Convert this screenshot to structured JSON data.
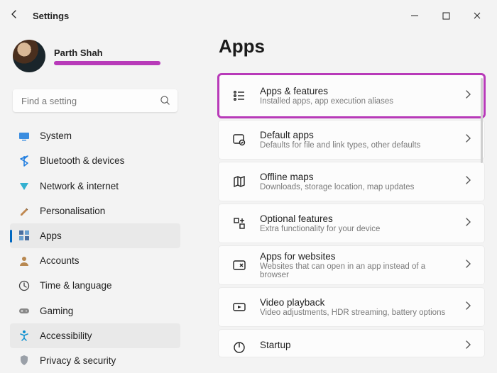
{
  "window": {
    "title": "Settings"
  },
  "profile": {
    "name": "Parth Shah"
  },
  "search": {
    "placeholder": "Find a setting"
  },
  "nav": {
    "items": [
      {
        "label": "System",
        "icon": "system"
      },
      {
        "label": "Bluetooth & devices",
        "icon": "bluetooth"
      },
      {
        "label": "Network & internet",
        "icon": "network"
      },
      {
        "label": "Personalisation",
        "icon": "personalisation"
      },
      {
        "label": "Apps",
        "icon": "apps"
      },
      {
        "label": "Accounts",
        "icon": "accounts"
      },
      {
        "label": "Time & language",
        "icon": "time"
      },
      {
        "label": "Gaming",
        "icon": "gaming"
      },
      {
        "label": "Accessibility",
        "icon": "accessibility"
      },
      {
        "label": "Privacy & security",
        "icon": "privacy"
      }
    ],
    "selected": 4
  },
  "page": {
    "title": "Apps",
    "cards": [
      {
        "title": "Apps & features",
        "sub": "Installed apps, app execution aliases",
        "highlight": true
      },
      {
        "title": "Default apps",
        "sub": "Defaults for file and link types, other defaults"
      },
      {
        "title": "Offline maps",
        "sub": "Downloads, storage location, map updates"
      },
      {
        "title": "Optional features",
        "sub": "Extra functionality for your device"
      },
      {
        "title": "Apps for websites",
        "sub": "Websites that can open in an app instead of a browser"
      },
      {
        "title": "Video playback",
        "sub": "Video adjustments, HDR streaming, battery options"
      },
      {
        "title": "Startup",
        "sub": ""
      }
    ]
  }
}
